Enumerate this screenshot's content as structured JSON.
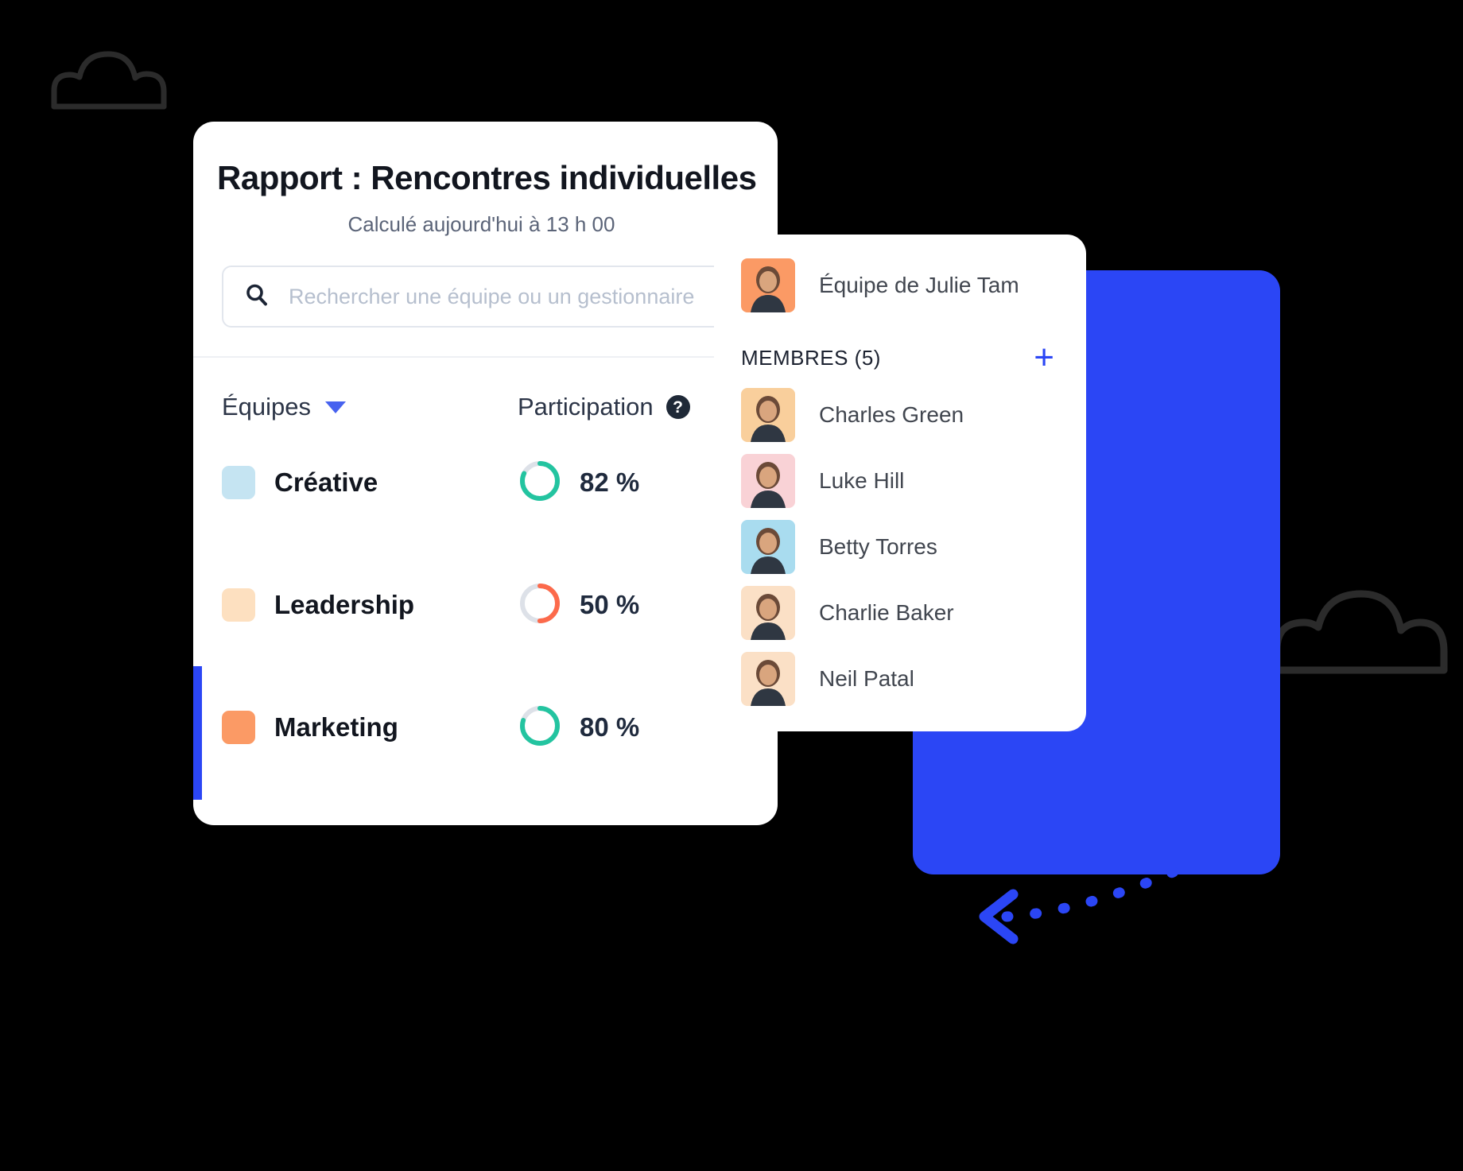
{
  "report": {
    "title": "Rapport : Rencontres individuelles",
    "subtitle": "Calculé aujourd'hui à 13 h 00",
    "search": {
      "placeholder": "Rechercher une équipe ou un gestionnaire",
      "value": "",
      "icon": "search-icon"
    },
    "columns": {
      "teams": "Équipes",
      "participation": "Participation",
      "help_glyph": "?",
      "sort_icon": "chevron-down-icon"
    },
    "rows": [
      {
        "team": "Créative",
        "swatch": "#c5e4f2",
        "participation": "82 %",
        "value": 82,
        "ring": "#23c4a0",
        "active": false
      },
      {
        "team": "Leadership",
        "swatch": "#fde0c0",
        "participation": "50 %",
        "value": 50,
        "ring": "#fc6a4b",
        "active": false
      },
      {
        "team": "Marketing",
        "swatch": "#fb9a65",
        "participation": "80 %",
        "value": 80,
        "ring": "#23c4a0",
        "active": true
      }
    ]
  },
  "team_panel": {
    "title": "Équipe de Julie Tam",
    "lead_avatar": {
      "name": "julie-tam-avatar",
      "bg": "#fb9a65"
    },
    "members_label": "MEMBRES (5)",
    "add_label": "+",
    "members": [
      {
        "name": "Charles Green",
        "bg": "#f9cf9c"
      },
      {
        "name": "Luke Hill",
        "bg": "#f9d2d6"
      },
      {
        "name": "Betty Torres",
        "bg": "#a9dcef"
      },
      {
        "name": "Charlie Baker",
        "bg": "#fbe0c6"
      },
      {
        "name": "Neil Patal",
        "bg": "#fbe0c6"
      }
    ]
  },
  "decor": {
    "cloud_left": "cloud-icon",
    "cloud_right": "cloud-icon",
    "arrow": "dotted-arrow-left-icon",
    "accent_color": "#2b46f5",
    "ring_track": "#dde1e8"
  }
}
